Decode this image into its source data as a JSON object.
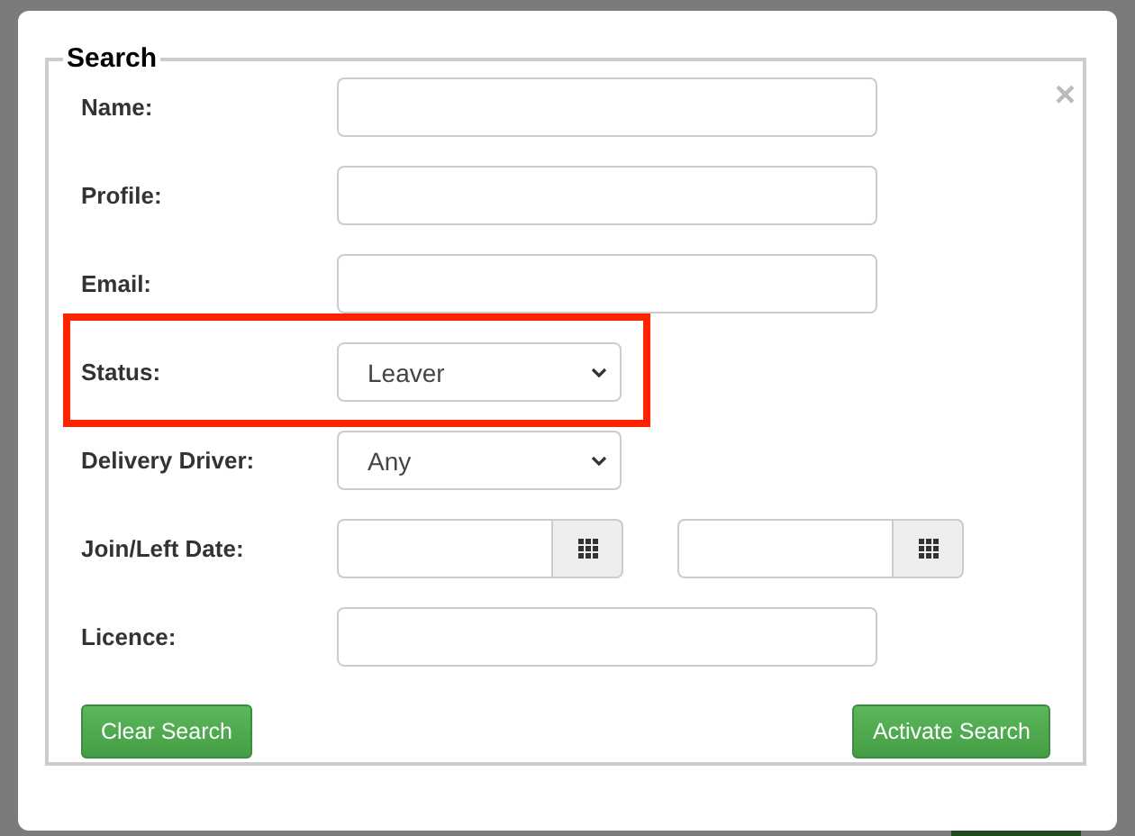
{
  "dialog": {
    "legend": "Search",
    "close": "×",
    "fields": [
      {
        "kind": "text",
        "label": "Name:",
        "highlighted": false
      },
      {
        "kind": "text",
        "label": "Profile:",
        "highlighted": false
      },
      {
        "kind": "text",
        "label": "Email:",
        "highlighted": false
      },
      {
        "kind": "select",
        "label": "Status:",
        "value": "Leaver",
        "highlighted": true
      },
      {
        "kind": "select",
        "label": "Delivery Driver:",
        "value": "Any",
        "highlighted": false
      },
      {
        "kind": "date_range",
        "label": "Join/Left Date:",
        "highlighted": false
      },
      {
        "kind": "text",
        "label": "Licence:",
        "highlighted": false
      }
    ],
    "buttons": [
      "Clear Search",
      "Activate Search"
    ]
  }
}
